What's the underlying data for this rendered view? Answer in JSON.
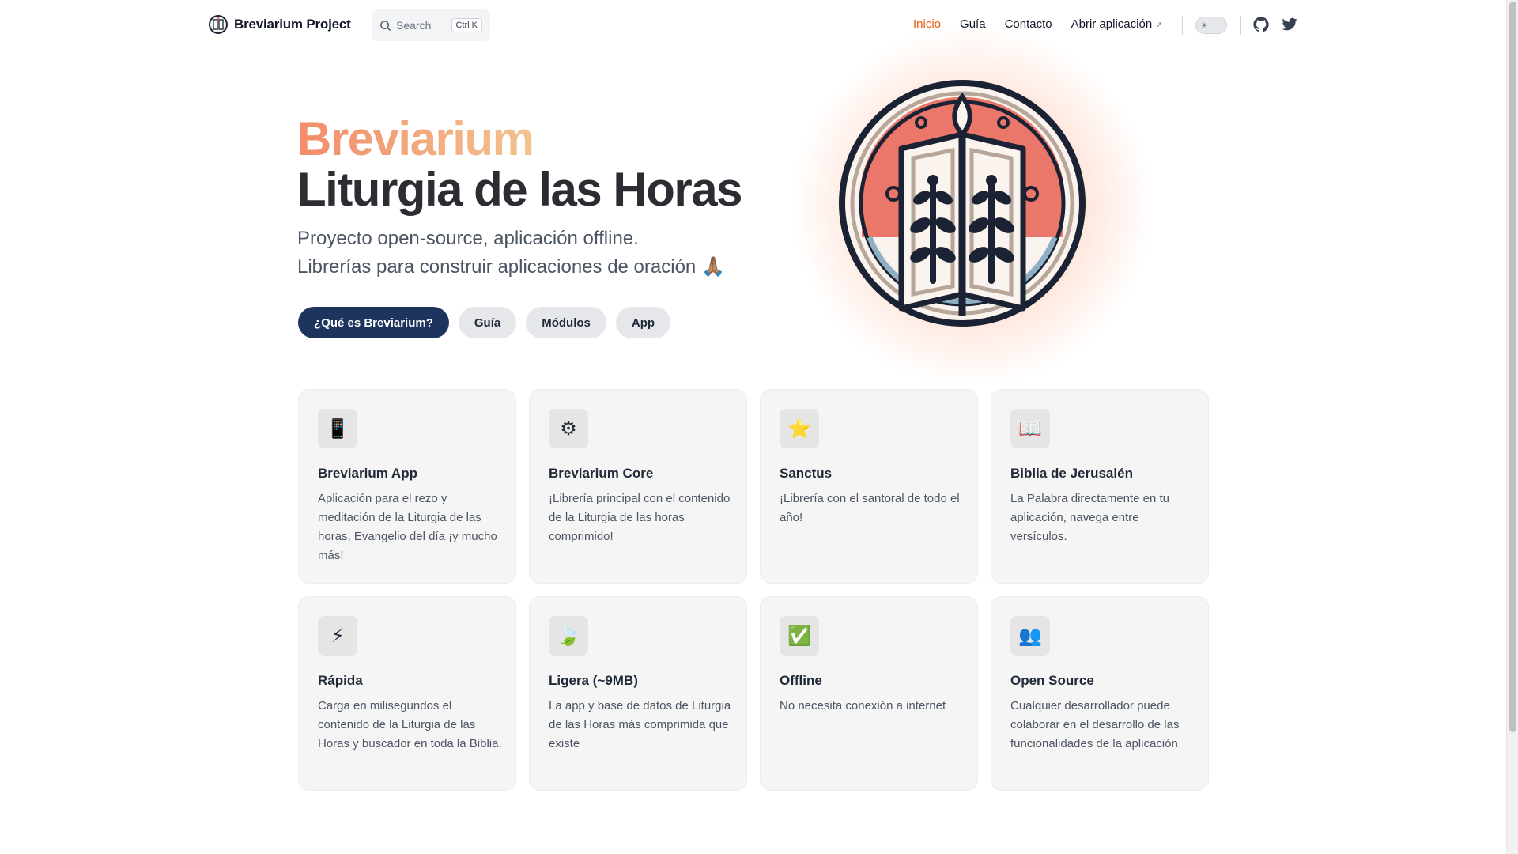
{
  "nav": {
    "brand": "Breviarium Project",
    "search_label": "Search",
    "search_shortcut": "Ctrl K",
    "links": [
      {
        "label": "Inicio",
        "active": true
      },
      {
        "label": "Guía"
      },
      {
        "label": "Contacto"
      },
      {
        "label": "Abrir aplicación",
        "external_mark": "↗"
      }
    ],
    "theme_toggle_icon": "sun-icon",
    "social": [
      "github-icon",
      "twitter-icon"
    ]
  },
  "hero": {
    "title_1": "Breviarium",
    "title_2": "Liturgia de las Horas",
    "subtitle_1": "Proyecto open-source, aplicación offline.",
    "subtitle_2": "Librerías para construir aplicaciones de oración 🙏🏽",
    "buttons": [
      "¿Qué es Breviarium?",
      "Guía",
      "Módulos",
      "App"
    ]
  },
  "cards": [
    {
      "icon": "📱",
      "icon_name": "mobile-phone-icon",
      "title": "Breviarium App",
      "desc": "Aplicación para el rezo y meditación de la Liturgia de las horas, Evangelio del día ¡y mucho más!"
    },
    {
      "icon": "⚙",
      "icon_name": "gear-icon",
      "title": "Breviarium Core",
      "desc": "¡Librería principal con el contenido de la Liturgia de las horas comprimido!"
    },
    {
      "icon": "⭐",
      "icon_name": "star-icon",
      "title": "Sanctus",
      "desc": "¡Librería con el santoral de todo el año!"
    },
    {
      "icon": "📖",
      "icon_name": "open-book-icon",
      "title": "Biblia de Jerusalén",
      "desc": "La Palabra directamente en tu aplicación, navega entre versículos."
    },
    {
      "icon": "⚡",
      "icon_name": "lightning-icon",
      "title": "Rápida",
      "desc": "Carga en milisegundos el contenido de la Liturgia de las Horas y buscador en toda la Biblia."
    },
    {
      "icon": "🍃",
      "icon_name": "leaf-icon",
      "title": "Ligera (~9MB)",
      "desc": "La app y base de datos de Liturgia de las Horas más comprimida que existe"
    },
    {
      "icon": "✅",
      "icon_name": "check-mark-icon",
      "title": "Offline",
      "desc": "No necesita conexión a internet"
    },
    {
      "icon": "👥",
      "icon_name": "users-icon",
      "title": "Open Source",
      "desc": "Cualquier desarrollador puede colaborar en el desarrollo de las funcionalidades de la aplicación"
    }
  ]
}
